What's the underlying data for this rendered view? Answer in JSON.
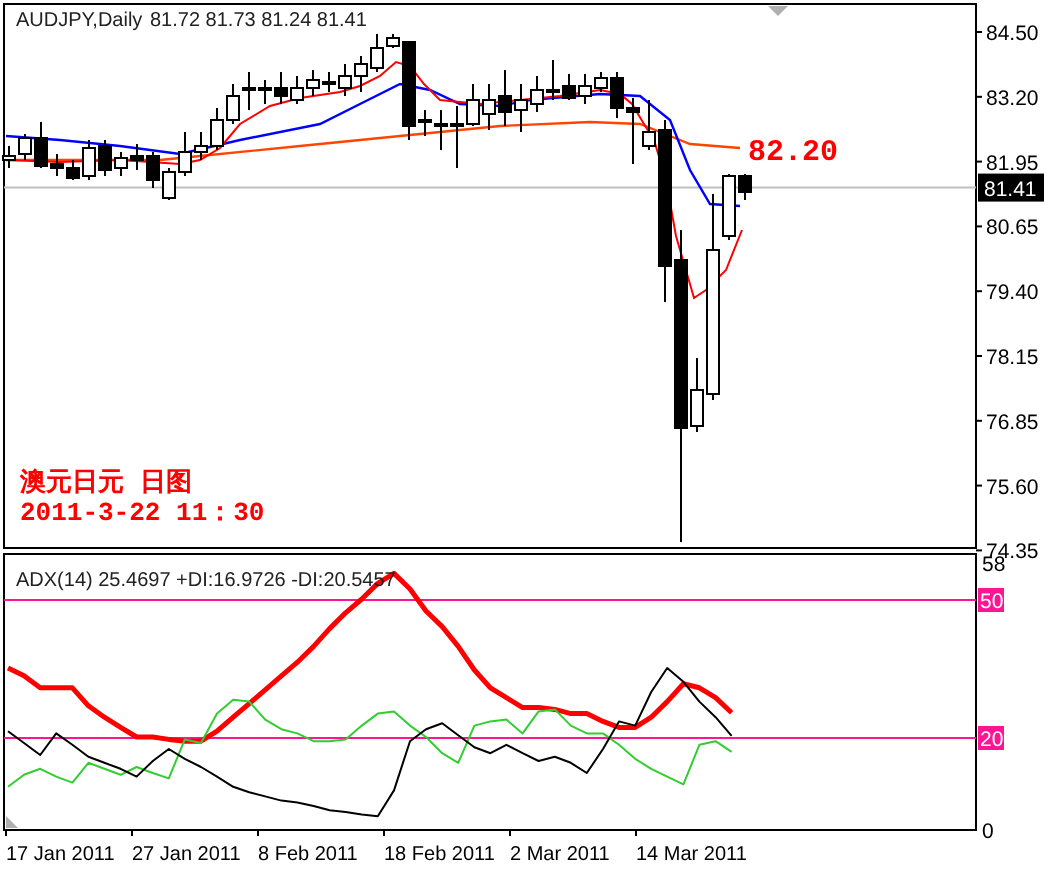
{
  "price_panel": {
    "symbol": "AUDJPY,Daily",
    "ohlc": "81.72 81.73 81.24 81.41",
    "price_labels": [
      "84.50",
      "83.20",
      "81.95",
      "80.65",
      "79.40",
      "78.15",
      "76.85",
      "75.60",
      "74.35"
    ],
    "current_price": "81.41",
    "annotation": "82.20",
    "caption_lines": [
      "澳元日元 日图",
      "2011-3-22 11：30"
    ]
  },
  "adx_panel": {
    "title": "ADX(14) 25.4697 +DI:16.9726 -DI:20.5457",
    "date_labels": [
      "17 Jan 2011",
      "27 Jan 2011",
      "8 Feb 2011",
      "18 Feb 2011",
      "2 Mar 2011",
      "14 Mar 2011"
    ],
    "chart_data": {
      "type": "line",
      "ylim": [
        0,
        60
      ],
      "yticks": [
        {
          "value": 58,
          "label": "58"
        },
        {
          "value": 50,
          "label": "50"
        },
        {
          "value": 20,
          "label": "20"
        },
        {
          "value": 0,
          "label": "0"
        }
      ],
      "series": [
        {
          "color": "#ff0000",
          "values": [
            35.2,
            33.5,
            30.9,
            30.9,
            30.9,
            27.0,
            24.5,
            22.3,
            20.2,
            20.2,
            19.7,
            19.3,
            19.3,
            21.5,
            24.5,
            27.5,
            30.5,
            33.5,
            36.5,
            39.9,
            43.8,
            47.2,
            50.2,
            53.6,
            55.8,
            52.4,
            47.6,
            44.2,
            39.9,
            34.8,
            30.9,
            28.8,
            26.6,
            26.6,
            26.2,
            25.3,
            25.3,
            23.6,
            22.3,
            22.3,
            24.5,
            27.9,
            31.8,
            30.9,
            28.8,
            25.5
          ]
        },
        {
          "color": "#32cd32",
          "values": [
            9.4,
            12.0,
            13.3,
            11.6,
            10.3,
            14.6,
            13.3,
            12.0,
            13.7,
            12.4,
            11.2,
            19.7,
            18.9,
            25.3,
            28.3,
            27.9,
            24.0,
            21.9,
            21.0,
            19.3,
            19.3,
            19.7,
            22.7,
            25.3,
            25.8,
            22.7,
            20.2,
            16.7,
            14.6,
            22.7,
            23.6,
            24.0,
            21.0,
            25.8,
            26.2,
            22.7,
            21.0,
            21.0,
            18.5,
            15.5,
            13.3,
            11.6,
            9.9,
            18.5,
            19.3,
            17.0
          ]
        },
        {
          "color": "#000000",
          "values": [
            21.5,
            18.9,
            16.3,
            21.0,
            18.5,
            15.9,
            14.6,
            13.3,
            11.6,
            15.0,
            17.6,
            15.5,
            13.7,
            11.6,
            9.4,
            8.2,
            7.3,
            6.4,
            6.0,
            5.2,
            4.3,
            3.9,
            3.4,
            3.0,
            8.6,
            19.3,
            21.9,
            23.2,
            20.6,
            18.0,
            16.7,
            18.5,
            16.7,
            15.0,
            15.9,
            14.6,
            12.4,
            17.6,
            23.6,
            22.7,
            30.0,
            35.2,
            32.2,
            27.9,
            24.5,
            20.5
          ]
        }
      ]
    }
  }
}
